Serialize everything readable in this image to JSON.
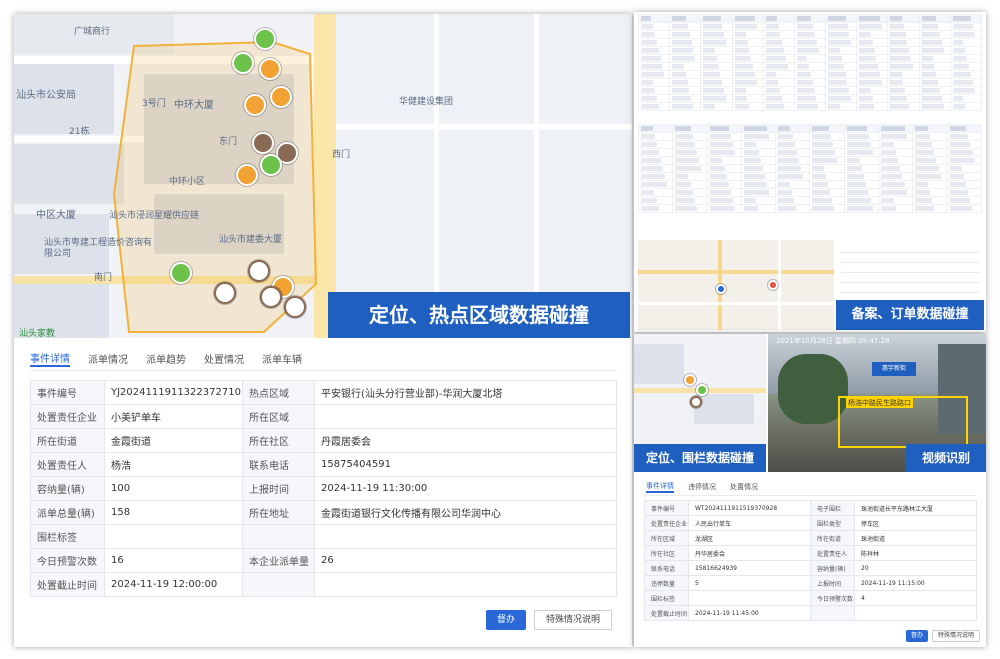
{
  "left": {
    "map": {
      "pois": [
        "广城商行",
        "汕头市公安局",
        "3号门",
        "中环大厦",
        "东门",
        "中环小区",
        "中区大厦",
        "汕头市粤建工程造价咨询有限公司",
        "南门",
        "汕头市建委大厦",
        "西门",
        "华健建设集团",
        "汕头市浸润星耀供应链",
        "21栋",
        "汕头家教"
      ],
      "polygon_color": "#f3b13a"
    },
    "banner": "定位、热点区域数据碰撞",
    "tabs": [
      "事件详情",
      "派单情况",
      "派单趋势",
      "处置情况",
      "派单车辆"
    ],
    "rows": [
      [
        "事件编号",
        "YJ2024111911322372710",
        "热点区域",
        "平安银行(汕头分行营业部)-华润大厦北塔"
      ],
      [
        "处置责任企业",
        "小美铲单车",
        "所在区域",
        ""
      ],
      [
        "所在街道",
        "金霞街道",
        "所在社区",
        "丹霞居委会"
      ],
      [
        "处置责任人",
        "杨浩",
        "联系电话",
        "15875404591"
      ],
      [
        "容纳量(辆)",
        "100",
        "上报时间",
        "2024-11-19 11:30:00"
      ],
      [
        "派单总量(辆)",
        "158",
        "所在地址",
        "金霞街道银行文化传播有限公司华润中心"
      ],
      [
        "围栏标签",
        "",
        "",
        ""
      ],
      [
        "今日预警次数",
        "16",
        "本企业派单量",
        "26"
      ],
      [
        "处置截止时间",
        "2024-11-19 12:00:00",
        "",
        ""
      ]
    ],
    "buttons": {
      "primary": "督办",
      "secondary": "特殊情况说明"
    }
  },
  "top_right": {
    "banner": "备案、订单数据碰撞"
  },
  "bottom_right": {
    "banner_left": "定位、围栏数据碰撞",
    "banner_right": "视频识别",
    "video_timestamp": "2021年10月28日 星期四 09:47:28",
    "video_label": "杨浩中路民生路路口",
    "video_sign": "惠宇新街",
    "tabs": [
      "事件详情",
      "违停情况",
      "处置情况"
    ],
    "rows": [
      [
        "事件编号",
        "WT2024111911519370928",
        "电子围栏",
        "珠池街道长平东路林江大厦"
      ],
      [
        "处置责任企业",
        "人民出行单车",
        "围栏类型",
        "停车区"
      ],
      [
        "所在区域",
        "龙湖区",
        "所在街道",
        "珠池街道"
      ],
      [
        "所在社区",
        "丹华居委会",
        "处置责任人",
        "陈祥林"
      ],
      [
        "联系电话",
        "15816624939",
        "容纳量(辆)",
        "20"
      ],
      [
        "违停数量",
        "5",
        "上报时间",
        "2024-11-19 11:15:00"
      ],
      [
        "围栏标签",
        "",
        "今日预警次数",
        "4"
      ],
      [
        "处置截止时间",
        "2024-11-19 11:45:00",
        "",
        ""
      ]
    ],
    "buttons": {
      "primary": "督办",
      "secondary": "特殊情况说明"
    }
  }
}
